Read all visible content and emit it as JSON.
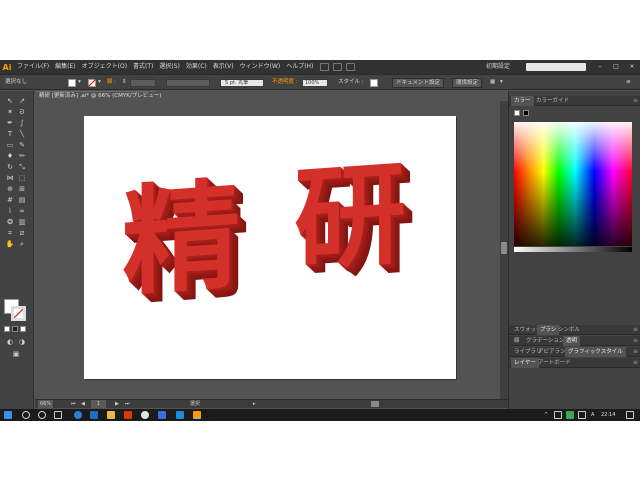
{
  "app": {
    "logo": "Ai"
  },
  "menu": {
    "items": [
      "ファイル(F)",
      "編集(E)",
      "オブジェクト(O)",
      "書式(T)",
      "選択(S)",
      "効果(C)",
      "表示(V)",
      "ウィンドウ(W)",
      "ヘルプ(H)"
    ],
    "workspace": "初期設定",
    "search_placeholder": ""
  },
  "control_bar": {
    "selection_label": "選択なし",
    "stroke_label": "線 :",
    "brush_label": "5 pt. 丸筆",
    "opacity_label": "不透明度 :",
    "opacity_value": "100%",
    "style_label": "スタイル :",
    "doc_setup": "ドキュメント設定",
    "preferences": "環境設定"
  },
  "document": {
    "tab_title": "精研 [更新済み] .ai* @ 66% (CMYK/プレビュー)",
    "close_glyph": "×"
  },
  "artboard": {
    "kanji_1": "精",
    "kanji_2": "研",
    "text_color": "#d4302a"
  },
  "status": {
    "zoom": "66%",
    "page": "1",
    "mode": "選択"
  },
  "panels": {
    "color_tabs": [
      "カラー",
      "カラーガイド"
    ],
    "swatch_tabs": [
      "スウォッチ",
      "ブラシ",
      "シンボル"
    ],
    "stroke_tabs": [
      "線",
      "グラデーション",
      "透明"
    ],
    "appearance_tabs": [
      "アピアランス",
      "グラフィックスタイル"
    ],
    "layer_tabs": [
      "レイヤー",
      "アートボード"
    ],
    "appearance_first": "ライブラリ"
  },
  "taskbar": {
    "time": "22:14",
    "ime": "A"
  },
  "colors": {
    "accent": "#ff9a00",
    "chrome": "#424242",
    "canvas": "#535353"
  }
}
